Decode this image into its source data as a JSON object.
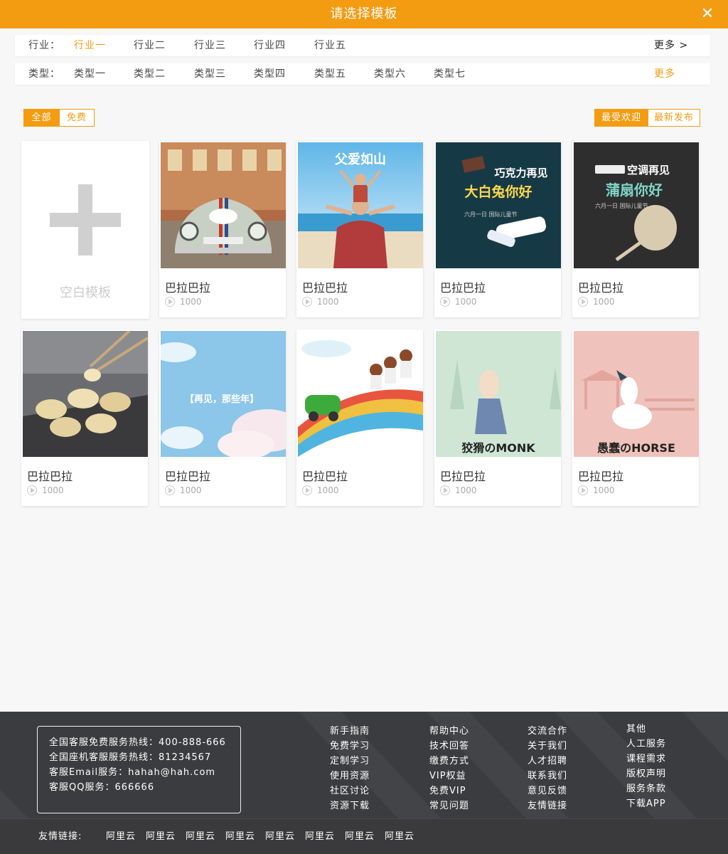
{
  "header": {
    "title": "请选择模板",
    "close_icon": "close-icon"
  },
  "filters": {
    "industry": {
      "label": "行业：",
      "options": [
        "行业一",
        "行业二",
        "行业三",
        "行业四",
        "行业五"
      ],
      "selected": "行业一",
      "more": "更多 >"
    },
    "type": {
      "label": "类型：",
      "options": [
        "类型一",
        "类型二",
        "类型三",
        "类型四",
        "类型五",
        "类型六",
        "类型七"
      ],
      "more": "更多"
    }
  },
  "toggles": {
    "price": {
      "options": [
        "全部",
        "免费"
      ],
      "selected": "全部"
    },
    "sort": {
      "options": [
        "最受欢迎",
        "最新发布"
      ],
      "selected": "最受欢迎"
    }
  },
  "blank_template": {
    "label": "空白模板",
    "icon": "plus-icon"
  },
  "templates": [
    {
      "name": "巴拉巴拉",
      "views": "1000",
      "thumb": "vintage-car-53"
    },
    {
      "name": "巴拉巴拉",
      "views": "1000",
      "thumb": "father-child-beach",
      "thumb_text": "父爱如山"
    },
    {
      "name": "巴拉巴拉",
      "views": "1000",
      "thumb": "chocolate-candy",
      "thumb_text": "巧克力再见",
      "thumb_text2": "大白兔你好",
      "thumb_text3": "六月一日 国际儿童节"
    },
    {
      "name": "巴拉巴拉",
      "views": "1000",
      "thumb": "aircon-fan",
      "thumb_text": "空调再见",
      "thumb_text2": "蒲扇你好",
      "thumb_text3": "六月一日 国际儿童节"
    },
    {
      "name": "巴拉巴拉",
      "views": "1000",
      "thumb": "dumplings"
    },
    {
      "name": "巴拉巴拉",
      "views": "1000",
      "thumb": "sky-clouds",
      "thumb_text": "【再见，那些年】"
    },
    {
      "name": "巴拉巴拉",
      "views": "1000",
      "thumb": "kids-car-rainbow"
    },
    {
      "name": "巴拉巴拉",
      "views": "1000",
      "thumb": "monk-cartoon",
      "thumb_text": "狡猾のMONK"
    },
    {
      "name": "巴拉巴拉",
      "views": "1000",
      "thumb": "horse-cartoon",
      "thumb_text": "愚蠢のHORSE"
    }
  ],
  "footer": {
    "contact": [
      "全国客服免费服务热线：400-888-666",
      "全国座机客服服务热线：81234567",
      "客服Email服务：hahah@hah.com",
      "客服QQ服务：666666"
    ],
    "columns": [
      [
        "新手指南",
        "免费学习",
        "定制学习",
        "使用资源",
        "社区讨论",
        "资源下载"
      ],
      [
        "帮助中心",
        "技术回答",
        "缴费方式",
        "VIP权益",
        "免费VIP",
        "常见问题"
      ],
      [
        "交流合作",
        "关于我们",
        "人才招聘",
        "联系我们",
        "意见反馈",
        "友情链接"
      ],
      [
        "其他",
        "人工服务",
        "课程需求",
        "版权声明",
        "服务条款",
        "下载APP"
      ]
    ],
    "friend_label": "友情链接:",
    "friend_links": [
      "阿里云",
      "阿里云",
      "阿里云",
      "阿里云",
      "阿里云",
      "阿里云",
      "阿里云",
      "阿里云"
    ]
  },
  "colors": {
    "accent": "#f39c12",
    "footer_bg": "#3b3c3f",
    "page_bg": "#f7f7f7"
  }
}
